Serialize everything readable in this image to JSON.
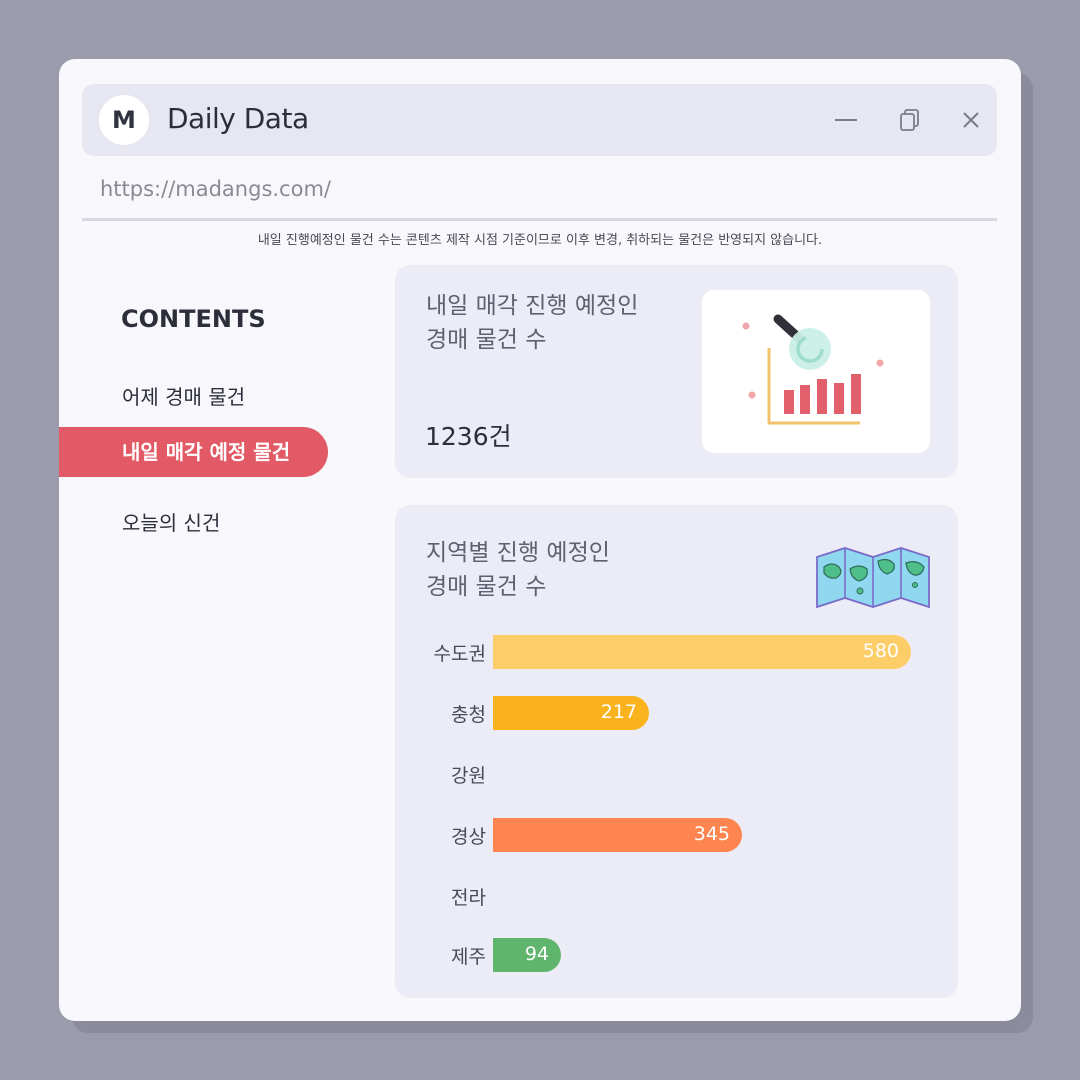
{
  "window": {
    "logo": "M",
    "title": "Daily Data",
    "url": "https://madangs.com/"
  },
  "notice": "내일 진행예정인 물건 수는 콘텐츠 제작 시점 기준이므로 이후 변경, 취하되는 물건은 반영되지 않습니다.",
  "sidebar": {
    "title": "CONTENTS",
    "items": [
      {
        "label": "어제 경매 물건"
      },
      {
        "label": "내일 매각 예정 물건"
      },
      {
        "label": "오늘의 신건"
      }
    ]
  },
  "card1": {
    "title_line1": "내일 매각 진행 예정인",
    "title_line2": "경매 물건 수",
    "count": "1236건"
  },
  "card2": {
    "title_line1": "지역별 진행 예정인",
    "title_line2": "경매 물건 수"
  },
  "chart_data": {
    "type": "bar",
    "orientation": "horizontal",
    "categories": [
      "수도권",
      "충청",
      "강원",
      "경상",
      "전라",
      "제주"
    ],
    "values": [
      580,
      217,
      null,
      345,
      null,
      94
    ],
    "value_labels": [
      "580",
      "217",
      "",
      "345",
      "",
      "94"
    ],
    "colors": [
      "#fdcd68",
      "#fab31d",
      "#fab31d",
      "#fe8550",
      "#5fb56c",
      "#5fb56c"
    ]
  },
  "colors": {
    "accent": "#e25a65",
    "background": "#9a9bad"
  }
}
